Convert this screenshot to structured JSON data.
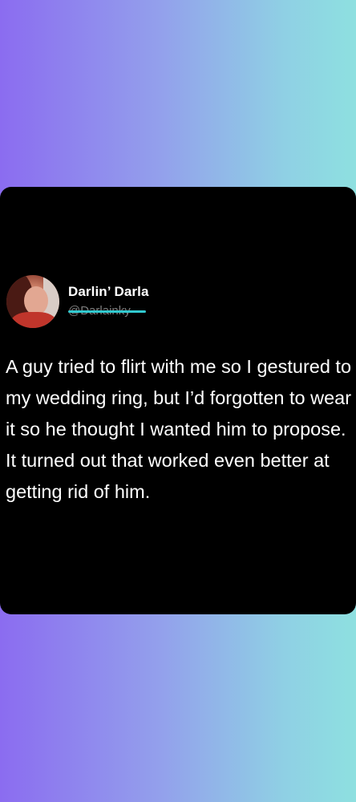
{
  "tweet": {
    "display_name": "Darlin’ Darla",
    "handle": "@Darlainky",
    "text": "A guy tried to flirt with me so I gestured to my wedding ring, but I’d forgotten to wear it so he thought I wanted him to propose. It turned out that worked even better at getting rid of him.",
    "handle_redaction_color": "#31c9cf"
  },
  "colors": {
    "background_gradient_start": "#8b6cf0",
    "background_gradient_end": "#8ee0e0",
    "card_background": "#000000",
    "text": "#ffffff"
  }
}
